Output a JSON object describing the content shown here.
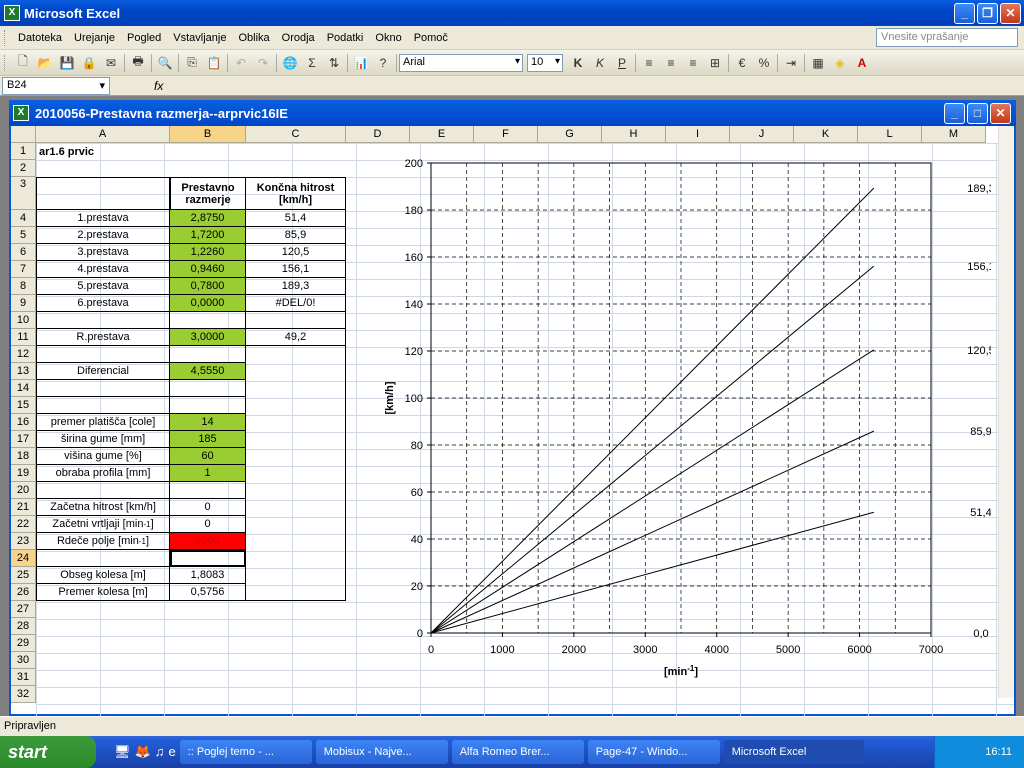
{
  "app": {
    "title": "Microsoft Excel"
  },
  "menu": [
    "Datoteka",
    "Urejanje",
    "Pogled",
    "Vstavljanje",
    "Oblika",
    "Orodja",
    "Podatki",
    "Okno",
    "Pomoč"
  ],
  "help_placeholder": "Vnesite vprašanje",
  "toolbar": {
    "font": "Arial",
    "size": "10"
  },
  "namebox": "B24",
  "fx": "fx",
  "doc": {
    "title": "2010056-Prestavna razmerja--arprvic16IE"
  },
  "columns": [
    "A",
    "B",
    "C",
    "D",
    "E",
    "F",
    "G",
    "H",
    "I",
    "J",
    "K",
    "L",
    "M"
  ],
  "rows": [
    "1",
    "2",
    "3",
    "4",
    "5",
    "6",
    "7",
    "8",
    "9",
    "10",
    "11",
    "12",
    "13",
    "14",
    "15",
    "16",
    "17",
    "18",
    "19",
    "20",
    "21",
    "22",
    "23",
    "24",
    "25",
    "26",
    "27",
    "28",
    "29",
    "30",
    "31",
    "32"
  ],
  "sheet": {
    "a1": "ar1.6 prvic",
    "b3": "Prestavno razmerje",
    "c3": "Končna hitrost [km/h]",
    "gears": [
      {
        "name": "1.prestava",
        "ratio": "2,8750",
        "speed": "51,4"
      },
      {
        "name": "2.prestava",
        "ratio": "1,7200",
        "speed": "85,9"
      },
      {
        "name": "3.prestava",
        "ratio": "1,2260",
        "speed": "120,5"
      },
      {
        "name": "4.prestava",
        "ratio": "0,9460",
        "speed": "156,1"
      },
      {
        "name": "5.prestava",
        "ratio": "0,7800",
        "speed": "189,3"
      },
      {
        "name": "6.prestava",
        "ratio": "0,0000",
        "speed": "#DEL/0!"
      }
    ],
    "reverse": {
      "name": "R.prestava",
      "ratio": "3,0000",
      "speed": "49,2"
    },
    "diff": {
      "name": "Diferencial",
      "value": "4,5550"
    },
    "rim": {
      "name": "premer platišča [cole]",
      "value": "14"
    },
    "width": {
      "name": "širina gume [mm]",
      "value": "185"
    },
    "height": {
      "name": "višina gume [%]",
      "value": "60"
    },
    "wear": {
      "name": "obraba profila [mm]",
      "value": "1"
    },
    "start_speed": {
      "name": "Začetna hitrost [km/h]",
      "value": "0"
    },
    "start_rpm": {
      "name": "Začetni vrtljaji [min",
      "sup": "-1",
      "close": "]",
      "value": "0"
    },
    "redline": {
      "name": "Rdeče polje [min",
      "sup": "-1",
      "close": "]",
      "value": "6200"
    },
    "circ": {
      "name": "Obseg kolesa [m]",
      "value": "1,8083"
    },
    "diam": {
      "name": "Premer kolesa [m]",
      "value": "0,5756"
    }
  },
  "chart_data": {
    "type": "line",
    "xlabel": "[min",
    "xlabel_sup": "-1",
    "xlabel_close": "]",
    "ylabel": "[km/h]",
    "xlim": [
      0,
      7000
    ],
    "ylim": [
      0,
      200
    ],
    "xticks": [
      0,
      1000,
      2000,
      3000,
      4000,
      5000,
      6000,
      7000
    ],
    "yticks": [
      0,
      20,
      40,
      60,
      80,
      100,
      120,
      140,
      160,
      180,
      200
    ],
    "grid": true,
    "series": [
      {
        "x": [
          0,
          6200
        ],
        "y": [
          0,
          51.4
        ]
      },
      {
        "x": [
          0,
          6200
        ],
        "y": [
          0,
          85.9
        ]
      },
      {
        "x": [
          0,
          6200
        ],
        "y": [
          0,
          120.5
        ]
      },
      {
        "x": [
          0,
          6200
        ],
        "y": [
          0,
          156.1
        ]
      },
      {
        "x": [
          0,
          6200
        ],
        "y": [
          0,
          189.3
        ]
      }
    ],
    "right_labels": [
      {
        "value": 189.3,
        "text": "189,3"
      },
      {
        "value": 156.1,
        "text": "156,1"
      },
      {
        "value": 120.5,
        "text": "120,5"
      },
      {
        "value": 85.9,
        "text": "85,9"
      },
      {
        "value": 51.4,
        "text": "51,4"
      },
      {
        "value": 0,
        "text": "0,0"
      }
    ]
  },
  "status": "Pripravljen",
  "taskbar": {
    "start": "start",
    "tasks": [
      ":: Poglej temo - ...",
      "Mobisux - Najve...",
      "Alfa Romeo Brer...",
      "Page-47 - Windo...",
      "Microsoft Excel"
    ],
    "clock": "16:11"
  }
}
